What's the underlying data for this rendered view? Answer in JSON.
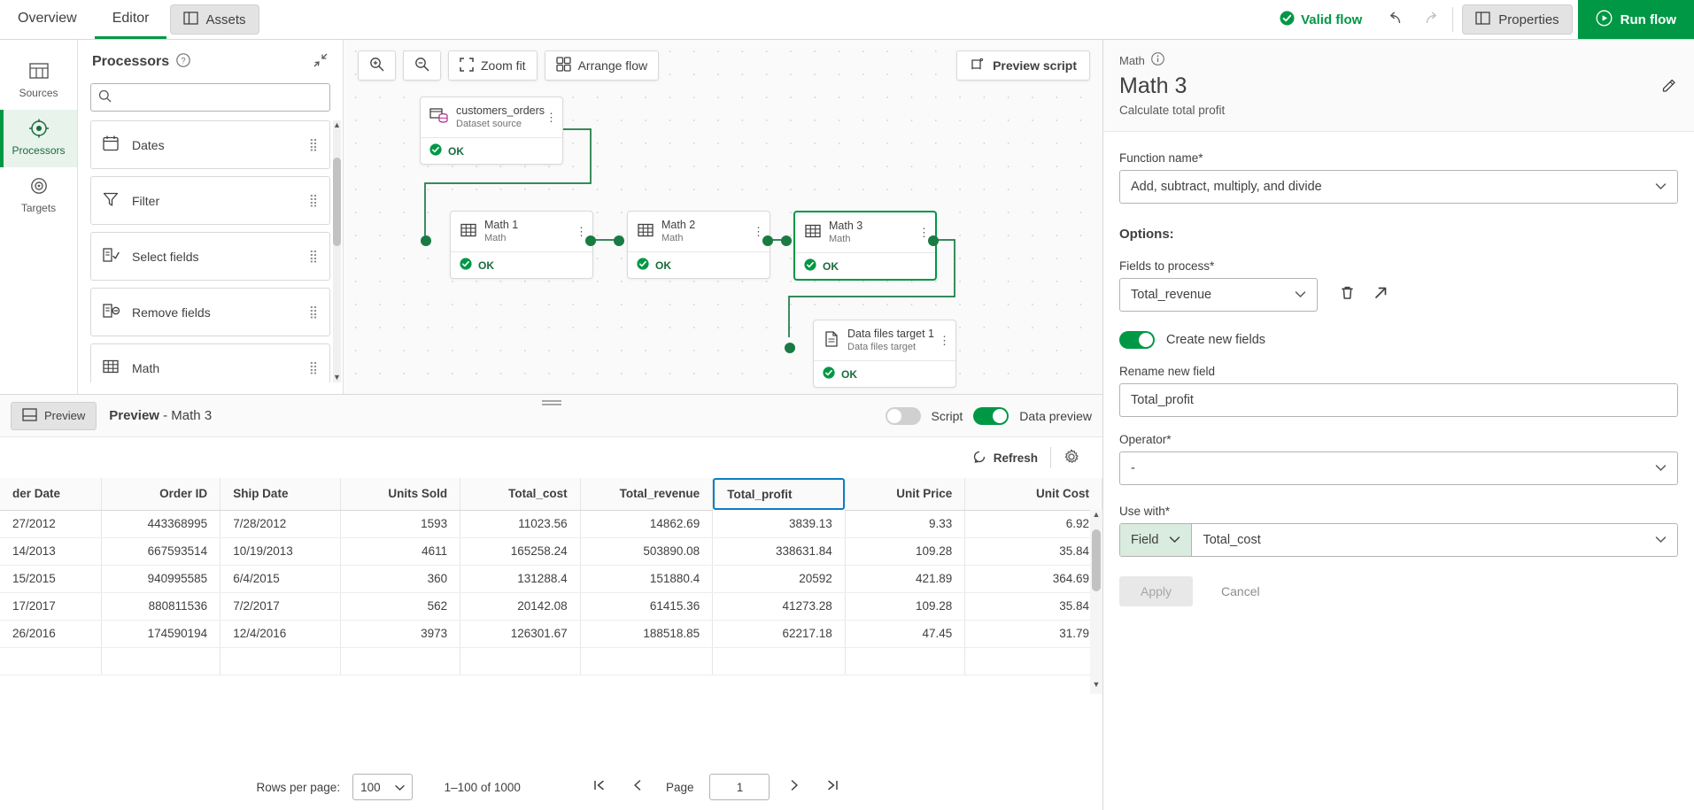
{
  "topbar": {
    "tabs": [
      {
        "label": "Overview",
        "active": false
      },
      {
        "label": "Editor",
        "active": true
      }
    ],
    "assets_label": "Assets",
    "valid_flow_label": "Valid flow",
    "properties_label": "Properties",
    "run_flow_label": "Run flow",
    "accent_green": "#009845"
  },
  "rail": {
    "items": [
      {
        "label": "Sources",
        "icon": "table-icon",
        "active": false
      },
      {
        "label": "Processors",
        "icon": "target-icon",
        "active": true
      },
      {
        "label": "Targets",
        "icon": "bullseye-icon",
        "active": false
      }
    ]
  },
  "processors": {
    "title": "Processors",
    "help_icon": "question-circle-icon",
    "collapse_icon": "collapse-icon",
    "search_placeholder": "",
    "search_value": "",
    "items": [
      {
        "label": "Dates",
        "icon": "calendar-icon"
      },
      {
        "label": "Filter",
        "icon": "funnel-icon"
      },
      {
        "label": "Select fields",
        "icon": "select-fields-icon"
      },
      {
        "label": "Remove fields",
        "icon": "remove-fields-icon"
      },
      {
        "label": "Math",
        "icon": "math-icon"
      }
    ]
  },
  "canvas": {
    "toolbar": {
      "zoom_in": "zoom-in-icon",
      "zoom_out": "zoom-out-icon",
      "zoom_fit_label": "Zoom fit",
      "arrange_flow_label": "Arrange flow",
      "preview_script_label": "Preview script"
    },
    "nodes": [
      {
        "name": "customers_orders",
        "subtitle": "Dataset source",
        "status": "OK",
        "icon": "dataset-icon",
        "selected": false
      },
      {
        "name": "Math 1",
        "subtitle": "Math",
        "status": "OK",
        "icon": "math-icon",
        "selected": false
      },
      {
        "name": "Math 2",
        "subtitle": "Math",
        "status": "OK",
        "icon": "math-icon",
        "selected": false
      },
      {
        "name": "Math 3",
        "subtitle": "Math",
        "status": "OK",
        "icon": "math-icon",
        "selected": true
      },
      {
        "name": "Data files target 1",
        "subtitle": "Data files target",
        "status": "OK",
        "icon": "file-target-icon",
        "selected": false
      }
    ]
  },
  "preview": {
    "toggle_button_label": "Preview",
    "title_bold": "Preview",
    "title_rest": "- Math 3",
    "script_label": "Script",
    "script_on": false,
    "data_preview_label": "Data preview",
    "data_preview_on": true,
    "refresh_label": "Refresh",
    "settings_icon": "gear-icon",
    "selected_column": "Total_profit",
    "columns": [
      {
        "label": "der Date",
        "align": "left"
      },
      {
        "label": "Order ID",
        "align": "right"
      },
      {
        "label": "Ship Date",
        "align": "left"
      },
      {
        "label": "Units Sold",
        "align": "right"
      },
      {
        "label": "Total_cost",
        "align": "right"
      },
      {
        "label": "Total_revenue",
        "align": "right"
      },
      {
        "label": "Total_profit",
        "align": "right"
      },
      {
        "label": "Unit Price",
        "align": "right"
      },
      {
        "label": "Unit Cost",
        "align": "right"
      }
    ],
    "rows": [
      [
        "27/2012",
        "443368995",
        "7/28/2012",
        "1593",
        "11023.56",
        "14862.69",
        "3839.13",
        "9.33",
        "6.92"
      ],
      [
        "14/2013",
        "667593514",
        "10/19/2013",
        "4611",
        "165258.24",
        "503890.08",
        "338631.84",
        "109.28",
        "35.84"
      ],
      [
        "15/2015",
        "940995585",
        "6/4/2015",
        "360",
        "131288.4",
        "151880.4",
        "20592",
        "421.89",
        "364.69"
      ],
      [
        "17/2017",
        "880811536",
        "7/2/2017",
        "562",
        "20142.08",
        "61415.36",
        "41273.28",
        "109.28",
        "35.84"
      ],
      [
        "26/2016",
        "174590194",
        "12/4/2016",
        "3973",
        "126301.67",
        "188518.85",
        "62217.18",
        "47.45",
        "31.79"
      ]
    ],
    "pager": {
      "rows_per_page_label": "Rows per page:",
      "rows_per_page_value": "100",
      "range_label": "1–100 of 1000",
      "page_label": "Page",
      "page_value": "1",
      "first_icon": "first-page-icon",
      "prev_icon": "prev-page-icon",
      "next_icon": "next-page-icon",
      "last_icon": "last-page-icon"
    }
  },
  "properties": {
    "kicker": "Math",
    "info_icon": "info-icon",
    "title": "Math 3",
    "edit_icon": "pencil-icon",
    "description": "Calculate total profit",
    "function_name_label": "Function name*",
    "function_name_value": "Add, subtract, multiply, and divide",
    "options_label": "Options:",
    "fields_to_process_label": "Fields to process*",
    "fields_to_process_value": "Total_revenue",
    "delete_icon": "trash-icon",
    "expand_icon": "open-external-icon",
    "create_new_fields_label": "Create new fields",
    "create_new_fields_on": true,
    "rename_new_field_label": "Rename new field",
    "rename_new_field_value": "Total_profit",
    "operator_label": "Operator*",
    "operator_value": "-",
    "use_with_label": "Use with*",
    "use_with_type": "Field",
    "use_with_value": "Total_cost",
    "apply_label": "Apply",
    "cancel_label": "Cancel"
  }
}
